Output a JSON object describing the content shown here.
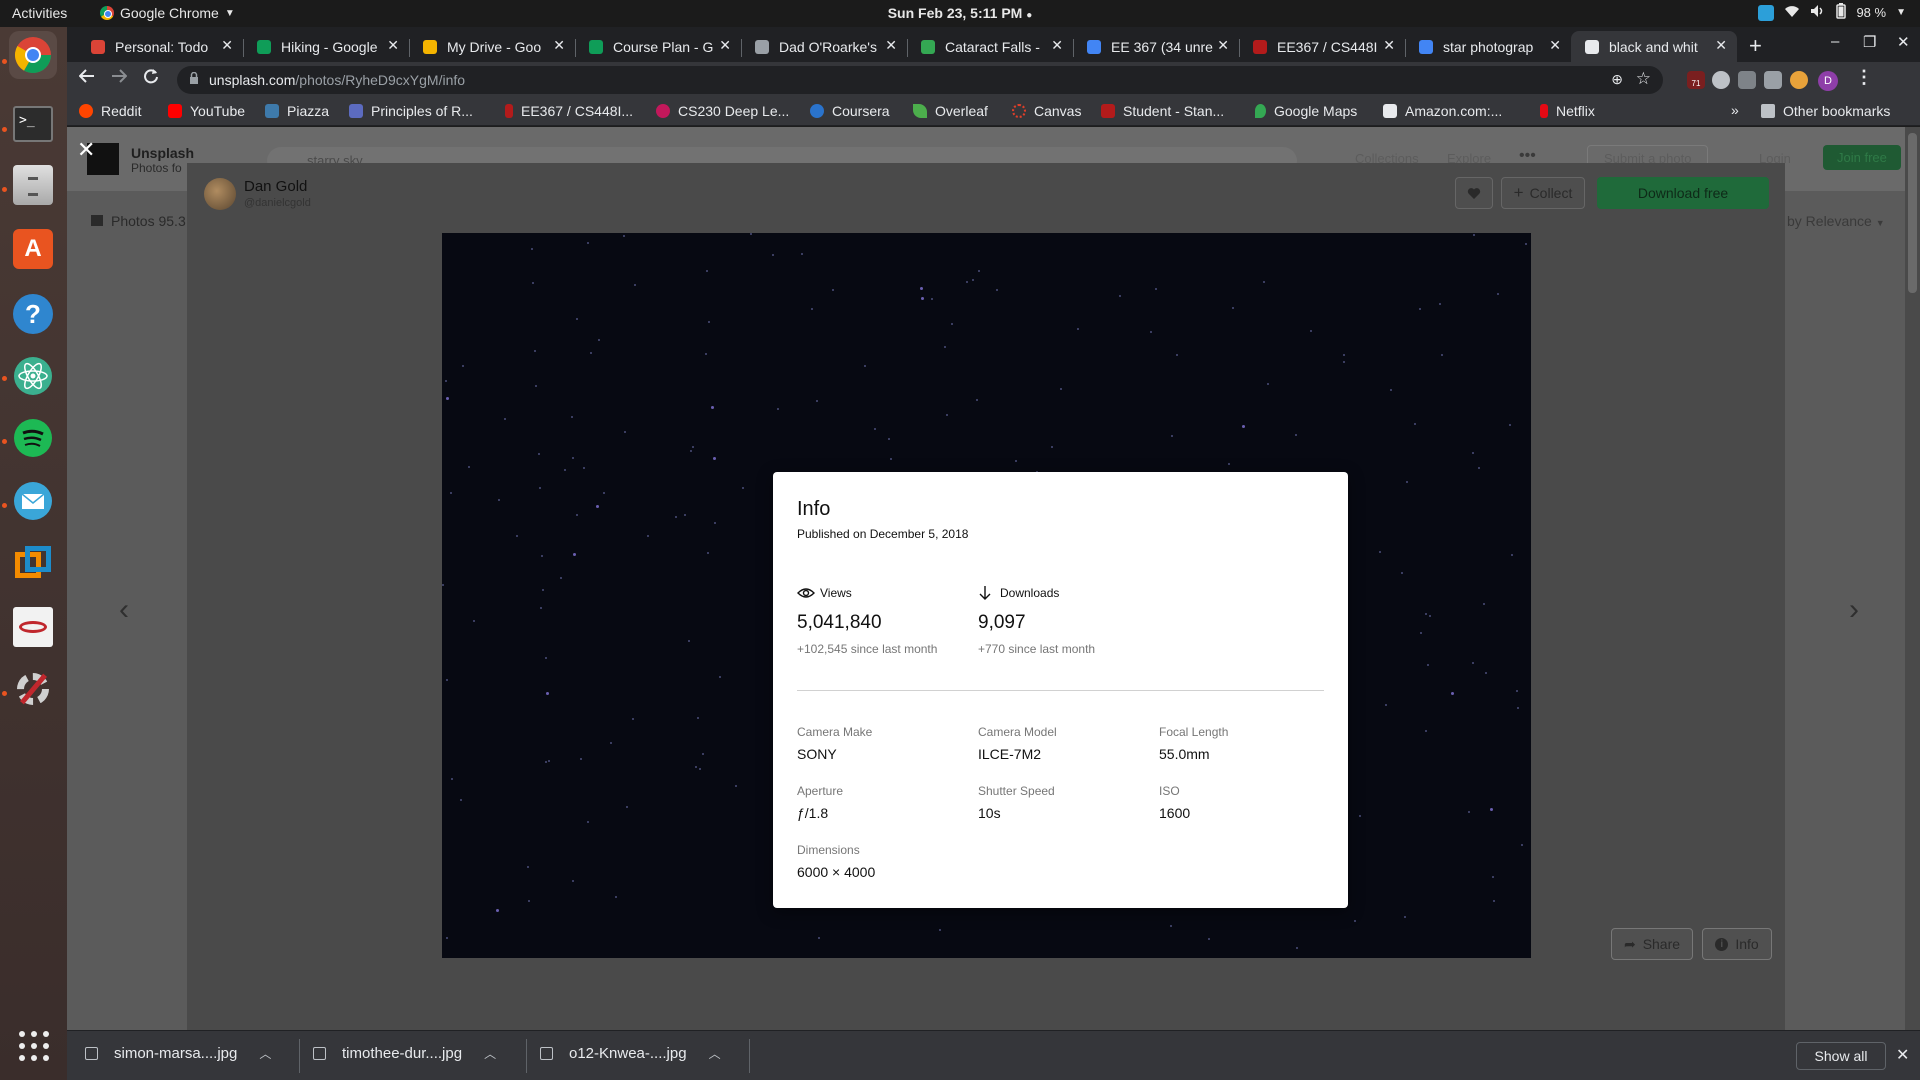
{
  "system": {
    "activities": "Activities",
    "app_name": "Google Chrome",
    "clock": "Sun Feb 23,  5:11 PM",
    "battery": "98 %"
  },
  "tabs": [
    {
      "title": "Personal: Todo",
      "color": "#db4437"
    },
    {
      "title": "Hiking - Google",
      "color": "#0f9d58"
    },
    {
      "title": "My Drive - Goo",
      "color": "#f4b400"
    },
    {
      "title": "Course Plan - G",
      "color": "#0f9d58"
    },
    {
      "title": "Dad O'Roarke's",
      "color": "#9aa0a6"
    },
    {
      "title": "Cataract Falls -",
      "color": "#34a853"
    },
    {
      "title": "EE 367 (34 unre",
      "color": "#4285f4"
    },
    {
      "title": "EE367 / CS448I",
      "color": "#b31b1b"
    },
    {
      "title": "star photograp",
      "color": "#4285f4"
    },
    {
      "title": "black and whit",
      "color": "#e8eaed"
    }
  ],
  "omnibox": {
    "host": "unsplash.com",
    "path": "/photos/RyheD9cxYgM/info"
  },
  "profile_initial": "D",
  "ext_badge": "71",
  "bookmarks": [
    {
      "label": "Reddit",
      "color": "#ff4500"
    },
    {
      "label": "YouTube",
      "color": "#ff0000"
    },
    {
      "label": "Piazza",
      "color": "#3e7aab"
    },
    {
      "label": "Principles of R...",
      "color": "#9aa0a6"
    },
    {
      "label": "EE367 / CS448I...",
      "color": "#b31b1b"
    },
    {
      "label": "CS230 Deep Le...",
      "color": "#c2185b"
    },
    {
      "label": "Coursera",
      "color": "#2a73cc"
    },
    {
      "label": "Overleaf",
      "color": "#4cae4c"
    },
    {
      "label": "Canvas",
      "color": "#e13f29"
    },
    {
      "label": "Student - Stan...",
      "color": "#b31b1b"
    },
    {
      "label": "Google Maps",
      "color": "#34a853"
    },
    {
      "label": "Amazon.com:...",
      "color": "#e8eaed"
    },
    {
      "label": "Netflix",
      "color": "#e50914"
    }
  ],
  "other_bookmarks": "Other bookmarks",
  "page": {
    "brand": "Unsplash",
    "brand_sub": "Photos fo",
    "search_text": "starry sky",
    "photos_tab": "Photos 95.3",
    "sort": "by Relevance",
    "author_name": "Dan Gold",
    "author_handle": "@danielcgold",
    "collect_label": "Collect",
    "download_label": "Download free",
    "share_label": "Share",
    "info_label": "Info",
    "header_links": [
      "Collections",
      "Explore"
    ],
    "submit_label": "Submit a photo",
    "login_label": "Login",
    "join_label": "Join free"
  },
  "info": {
    "title": "Info",
    "published": "Published on December 5, 2018",
    "views_label": "Views",
    "views_value": "5,041,840",
    "views_delta": "+102,545 since last month",
    "downloads_label": "Downloads",
    "downloads_value": "9,097",
    "downloads_delta": "+770 since last month",
    "details": [
      {
        "label": "Camera Make",
        "value": "SONY"
      },
      {
        "label": "Camera Model",
        "value": "ILCE-7M2"
      },
      {
        "label": "Focal Length",
        "value": "55.0mm"
      },
      {
        "label": "Aperture",
        "value": "ƒ/1.8"
      },
      {
        "label": "Shutter Speed",
        "value": "10s"
      },
      {
        "label": "ISO",
        "value": "1600"
      },
      {
        "label": "Dimensions",
        "value": "6000 × 4000"
      }
    ]
  },
  "downloads_bar": {
    "files": [
      "simon-marsa....jpg",
      "timothee-dur....jpg",
      "o12-Knwea-....jpg"
    ],
    "show_all": "Show all"
  }
}
